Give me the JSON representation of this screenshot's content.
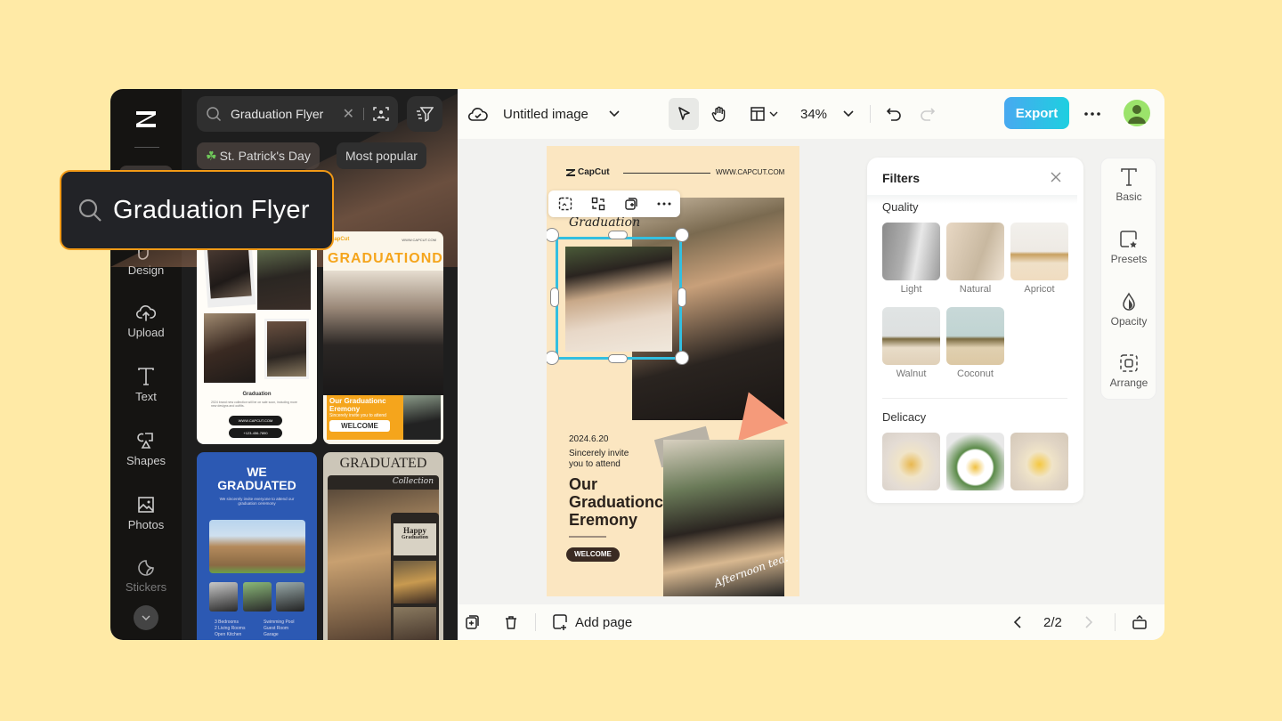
{
  "callout": {
    "text": "Graduation Flyer",
    "icon": "search-icon"
  },
  "rail": {
    "items": [
      {
        "label": "Design",
        "icon": "design-icon"
      },
      {
        "label": "Upload",
        "icon": "upload-icon"
      },
      {
        "label": "Text",
        "icon": "text-icon"
      },
      {
        "label": "Shapes",
        "icon": "shapes-icon"
      },
      {
        "label": "Photos",
        "icon": "photos-icon"
      },
      {
        "label": "Stickers",
        "icon": "stickers-icon"
      }
    ]
  },
  "panel": {
    "search_value": "Graduation Flyer",
    "chips": [
      {
        "label": "St. Patrick's Day",
        "icon": "clover"
      },
      {
        "label": "Most popular"
      }
    ],
    "templates": [
      {
        "title": "Graduation",
        "body": "2024 brand new collection will be on sale soon, including more new designs and outfits.",
        "buttons": [
          "WWW.CAPCUT.COM",
          "+123-456-7890"
        ]
      },
      {
        "brand": "CapCut",
        "url": "WWW.CAPCUT.COM",
        "headline": "GRADUATIOND",
        "sub1": "Our Graduationc",
        "sub2": "Eremony",
        "sub3": "Sincerely invite you to attend",
        "cta": "WELCOME"
      },
      {
        "headline1": "WE",
        "headline2": "GRADUATED",
        "body": "We sincerely invite everyone to attend our graduation ceremony",
        "features": [
          "3 Bedrooms",
          "2 Living Rooms",
          "Open Kitchen",
          "Swimming Pool",
          "Guest Room",
          "Garage"
        ]
      },
      {
        "headline": "GRADUATED",
        "script": "Collection",
        "inner1": "Happy",
        "inner2": "Graduation"
      }
    ]
  },
  "topbar": {
    "doc_title": "Untitled image",
    "zoom": "34%",
    "export_label": "Export"
  },
  "canvas": {
    "brand": "CapCut",
    "url": "WWW.CAPCUT.COM",
    "script_title": "Graduation",
    "date": "2024.6.20",
    "invite1": "Sincerely invite",
    "invite2": "you to attend",
    "headline1": "Our",
    "headline2": "Graduationc",
    "headline3": "Eremony",
    "cta": "WELCOME",
    "signature": "Afternoon tea."
  },
  "filters": {
    "title": "Filters",
    "sections": [
      {
        "name": "Quality",
        "items": [
          "Light",
          "Natural",
          "Apricot",
          "Walnut",
          "Coconut"
        ]
      },
      {
        "name": "Delicacy",
        "items": [
          "",
          "",
          ""
        ]
      }
    ]
  },
  "props": {
    "items": [
      "Basic",
      "Presets",
      "Opacity",
      "Arrange"
    ]
  },
  "bottombar": {
    "add_page": "Add page",
    "page_indicator": "2/2"
  }
}
